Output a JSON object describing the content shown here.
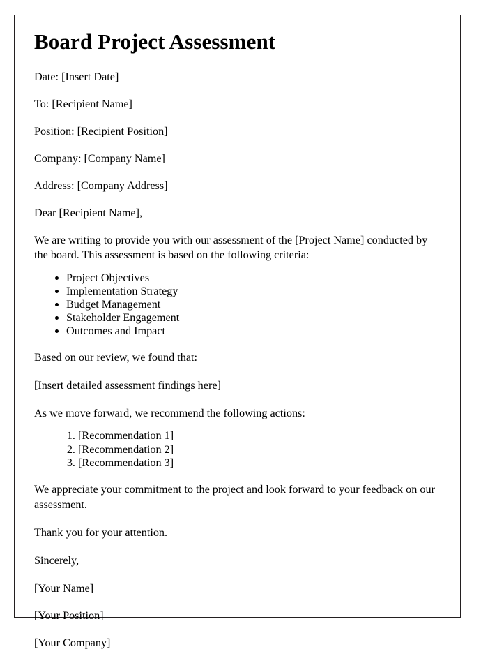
{
  "document": {
    "title": "Board Project Assessment",
    "header_fields": [
      "Date: [Insert Date]",
      "To: [Recipient Name]",
      "Position: [Recipient Position]",
      "Company: [Company Name]",
      "Address: [Company Address]"
    ],
    "salutation": "Dear [Recipient Name],",
    "intro_paragraph": "We are writing to provide you with our assessment of the [Project Name] conducted by the board. This assessment is based on the following criteria:",
    "criteria_items": [
      "Project Objectives",
      "Implementation Strategy",
      "Budget Management",
      "Stakeholder Engagement",
      "Outcomes and Impact"
    ],
    "findings_intro": "Based on our review, we found that:",
    "findings_placeholder": "[Insert detailed assessment findings here]",
    "recommendations_intro": "As we move forward, we recommend the following actions:",
    "recommendation_items": [
      "[Recommendation 1]",
      "[Recommendation 2]",
      "[Recommendation 3]"
    ],
    "appreciation_paragraph": "We appreciate your commitment to the project and look forward to your feedback on our assessment.",
    "thanks_line": "Thank you for your attention.",
    "closing": "Sincerely,",
    "signature_block": [
      "[Your Name]",
      "[Your Position]",
      "[Your Company]"
    ]
  },
  "style": {
    "border_color": "#231f20",
    "text_color": "#000000",
    "background_color": "#ffffff"
  }
}
